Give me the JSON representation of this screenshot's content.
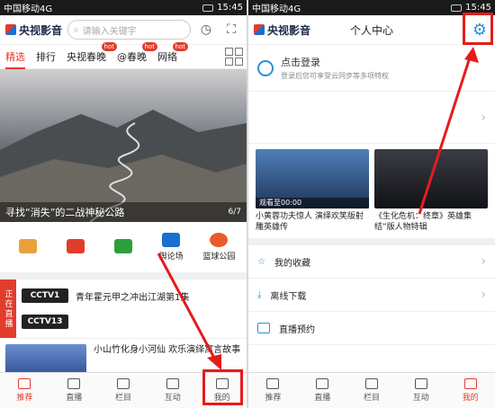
{
  "left": {
    "status": {
      "carrier": "中国移动4G",
      "time": "15:45"
    },
    "app_logo": "央视影音",
    "search": {
      "placeholder": "请输入关键字"
    },
    "tabs": [
      {
        "label": "精选",
        "hot": ""
      },
      {
        "label": "排行",
        "hot": ""
      },
      {
        "label": "央视春晚",
        "hot": "hot"
      },
      {
        "label": "@春晚",
        "hot": "hot"
      },
      {
        "label": "网络",
        "hot": "hot"
      }
    ],
    "banner": {
      "caption": "寻找“消失”的二战神秘公路",
      "pager": "6/7"
    },
    "quick_items": [
      {
        "label": "",
        "color": "#e9a23b"
      },
      {
        "label": "",
        "color": "#e23c2c"
      },
      {
        "label": "",
        "color": "#2e9e3c"
      },
      {
        "label": "舆论场",
        "color": "#1a6fd1"
      },
      {
        "label": "篮球公园",
        "color": "#e85b2a"
      }
    ],
    "live": {
      "tag": "正在直播",
      "rows": [
        {
          "channel": "CCTV1",
          "title": "青年霍元甲之冲出江湖第1集"
        },
        {
          "channel": "CCTV13",
          "title": ""
        }
      ]
    },
    "news": {
      "title": "小山竹化身小河仙 欢乐演绎寓言故事"
    },
    "nav": [
      {
        "label": "推荐",
        "active": true
      },
      {
        "label": "直播",
        "active": false
      },
      {
        "label": "栏目",
        "active": false
      },
      {
        "label": "互动",
        "active": false
      },
      {
        "label": "我的",
        "active": false
      }
    ]
  },
  "right": {
    "status": {
      "carrier": "中国移动4G",
      "time": "15:45"
    },
    "app_logo": "央视影音",
    "title": "个人中心",
    "login": {
      "title": "点击登录",
      "subtitle": "登录后您可享受云同步等多项特权"
    },
    "videos": [
      {
        "title": "小黄蓉功夫惊人 演绎欢笑版射雕英雄传",
        "overlay": "观看至00:00"
      },
      {
        "title": "《生化危机：终章》英雄集结”版人物特辑",
        "overlay": ""
      }
    ],
    "menu": [
      {
        "label": "我的收藏"
      },
      {
        "label": "离线下载"
      },
      {
        "label": "直播预约"
      }
    ],
    "nav": [
      {
        "label": "推荐",
        "active": false
      },
      {
        "label": "直播",
        "active": false
      },
      {
        "label": "栏目",
        "active": false
      },
      {
        "label": "互动",
        "active": false
      },
      {
        "label": "我的",
        "active": true
      }
    ]
  },
  "colors": {
    "accent": "#e23c2c",
    "highlight": "#e51c1c",
    "blue": "#2e8fd0"
  }
}
